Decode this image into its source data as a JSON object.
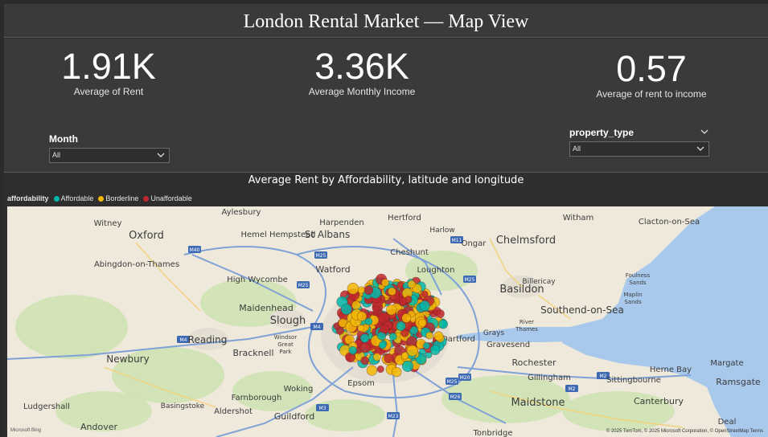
{
  "header": {
    "title": "London Rental Market — Map View"
  },
  "kpis": [
    {
      "value": "1.91K",
      "label": "Average of Rent"
    },
    {
      "value": "3.36K",
      "label": "Average Monthly Income"
    },
    {
      "value": "0.57",
      "label": "Average of rent  to  income"
    }
  ],
  "slicers": {
    "month": {
      "title": "Month",
      "value": "All"
    },
    "property_type": {
      "title": "property_type",
      "value": "All"
    }
  },
  "visual": {
    "title": "Average Rent by Affordability, latitude and longitude",
    "legend": {
      "title": "affordability",
      "items": [
        {
          "label": "Affordable",
          "color": "#01B8AA"
        },
        {
          "label": "Borderline",
          "color": "#F2B705"
        },
        {
          "label": "Unaffordable",
          "color": "#C0282D"
        }
      ]
    }
  },
  "map": {
    "places": [
      "Aylesbury",
      "Harpenden",
      "Hertford",
      "Witham",
      "Clacton-on-Sea",
      "Witney",
      "Oxford",
      "Hemel Hempstead",
      "St Albans",
      "Harlow",
      "Ongar",
      "Chelmsford",
      "Cheshunt",
      "Abingdon-on-Thames",
      "Watford",
      "Loughton",
      "High Wycombe",
      "Billericay",
      "Basildon",
      "Foulness Sands",
      "Maidenhead",
      "Slough",
      "Southend-on-Sea",
      "Maplin Sands",
      "Windsor Great Park",
      "Grays",
      "River Thames",
      "Reading",
      "Bracknell",
      "Dartford",
      "Gravesend",
      "Newbury",
      "Rochester",
      "Herne Bay",
      "Margate",
      "Gillingham",
      "Sittingbourne",
      "Epsom",
      "Woking",
      "Ludgershall",
      "Basingstoke",
      "Farnborough",
      "Aldershot",
      "Guildford",
      "Maidstone",
      "Canterbury",
      "Ramsgate",
      "Andover",
      "Tonbridge",
      "Deal"
    ],
    "roads": [
      "M40",
      "M25",
      "M11",
      "M25",
      "M25",
      "M4",
      "M4",
      "M25",
      "M26",
      "M20",
      "M2",
      "M2",
      "M3",
      "M23"
    ],
    "attribution": "© 2025 TomTom, © 2025 Microsoft Corporation, © OpenStreetMap  Terms",
    "brand": "Microsoft Bing"
  }
}
